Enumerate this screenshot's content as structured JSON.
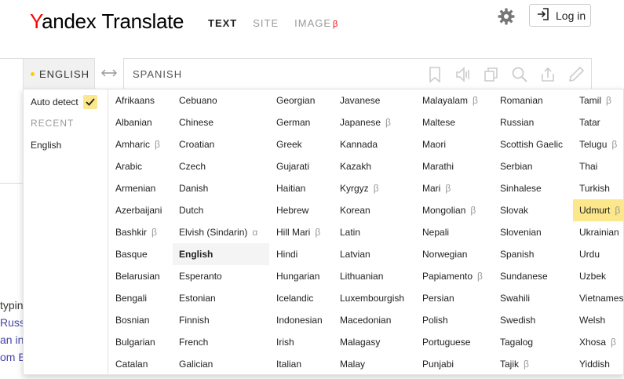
{
  "header": {
    "logo_y": "Y",
    "logo_andex": "andex",
    "logo_translate": "Translate",
    "modes": [
      {
        "label": "TEXT",
        "active": true,
        "beta": ""
      },
      {
        "label": "SITE",
        "active": false,
        "beta": ""
      },
      {
        "label": "IMAGE",
        "active": false,
        "beta": "β"
      }
    ],
    "login_label": "Log in",
    "settings_icon": "gear-icon",
    "login_icon": "login-icon"
  },
  "langbar": {
    "source": "ENGLISH",
    "target": "SPANISH",
    "swap_icon": "swap-arrows-icon",
    "tools": [
      "bookmark-icon",
      "speaker-icon",
      "copy-icon",
      "search-icon",
      "share-icon",
      "pencil-icon"
    ]
  },
  "background": {
    "lines": [
      {
        "text": "typin",
        "link": false
      },
      {
        "text": "Russ",
        "link": true
      },
      {
        "text": "an in",
        "link": true
      },
      {
        "text": "om E",
        "link": true
      }
    ]
  },
  "dropdown": {
    "auto_detect": "Auto detect",
    "recent_heading": "RECENT",
    "recent": [
      "English"
    ],
    "columns": [
      [
        {
          "name": "Afrikaans"
        },
        {
          "name": "Albanian"
        },
        {
          "name": "Amharic",
          "beta": "β"
        },
        {
          "name": "Arabic"
        },
        {
          "name": "Armenian"
        },
        {
          "name": "Azerbaijani"
        },
        {
          "name": "Bashkir",
          "beta": "β"
        },
        {
          "name": "Basque"
        },
        {
          "name": "Belarusian"
        },
        {
          "name": "Bengali"
        },
        {
          "name": "Bosnian"
        },
        {
          "name": "Bulgarian"
        },
        {
          "name": "Catalan"
        }
      ],
      [
        {
          "name": "Cebuano"
        },
        {
          "name": "Chinese"
        },
        {
          "name": "Croatian"
        },
        {
          "name": "Czech"
        },
        {
          "name": "Danish"
        },
        {
          "name": "Dutch"
        },
        {
          "name": "Elvish (Sindarin)",
          "beta": "α"
        },
        {
          "name": "English",
          "selected": true
        },
        {
          "name": "Esperanto"
        },
        {
          "name": "Estonian"
        },
        {
          "name": "Finnish"
        },
        {
          "name": "French"
        },
        {
          "name": "Galician"
        }
      ],
      [
        {
          "name": "Georgian"
        },
        {
          "name": "German"
        },
        {
          "name": "Greek"
        },
        {
          "name": "Gujarati"
        },
        {
          "name": "Haitian"
        },
        {
          "name": "Hebrew"
        },
        {
          "name": "Hill Mari",
          "beta": "β"
        },
        {
          "name": "Hindi"
        },
        {
          "name": "Hungarian"
        },
        {
          "name": "Icelandic"
        },
        {
          "name": "Indonesian"
        },
        {
          "name": "Irish"
        },
        {
          "name": "Italian"
        }
      ],
      [
        {
          "name": "Javanese"
        },
        {
          "name": "Japanese",
          "beta": "β"
        },
        {
          "name": "Kannada"
        },
        {
          "name": "Kazakh"
        },
        {
          "name": "Kyrgyz",
          "beta": "β"
        },
        {
          "name": "Korean"
        },
        {
          "name": "Latin"
        },
        {
          "name": "Latvian"
        },
        {
          "name": "Lithuanian"
        },
        {
          "name": "Luxembourgish"
        },
        {
          "name": "Macedonian"
        },
        {
          "name": "Malagasy"
        },
        {
          "name": "Malay"
        }
      ],
      [
        {
          "name": "Malayalam",
          "beta": "β"
        },
        {
          "name": "Maltese"
        },
        {
          "name": "Maori"
        },
        {
          "name": "Marathi"
        },
        {
          "name": "Mari",
          "beta": "β"
        },
        {
          "name": "Mongolian",
          "beta": "β"
        },
        {
          "name": "Nepali"
        },
        {
          "name": "Norwegian"
        },
        {
          "name": "Papiamento",
          "beta": "β"
        },
        {
          "name": "Persian"
        },
        {
          "name": "Polish"
        },
        {
          "name": "Portuguese"
        },
        {
          "name": "Punjabi"
        }
      ],
      [
        {
          "name": "Romanian"
        },
        {
          "name": "Russian"
        },
        {
          "name": "Scottish Gaelic"
        },
        {
          "name": "Serbian"
        },
        {
          "name": "Sinhalese"
        },
        {
          "name": "Slovak"
        },
        {
          "name": "Slovenian"
        },
        {
          "name": "Spanish"
        },
        {
          "name": "Sundanese"
        },
        {
          "name": "Swahili"
        },
        {
          "name": "Swedish"
        },
        {
          "name": "Tagalog"
        },
        {
          "name": "Tajik",
          "beta": "β"
        }
      ],
      [
        {
          "name": "Tamil",
          "beta": "β"
        },
        {
          "name": "Tatar"
        },
        {
          "name": "Telugu",
          "beta": "β"
        },
        {
          "name": "Thai"
        },
        {
          "name": "Turkish"
        },
        {
          "name": "Udmurt",
          "beta": "β",
          "highlighted": true
        },
        {
          "name": "Ukrainian"
        },
        {
          "name": "Urdu"
        },
        {
          "name": "Uzbek"
        },
        {
          "name": "Vietnamese"
        },
        {
          "name": "Welsh"
        },
        {
          "name": "Xhosa",
          "beta": "β"
        },
        {
          "name": "Yiddish"
        }
      ]
    ],
    "colors": {
      "highlight": "#fce78b",
      "selected_bg": "#f4f4f4",
      "beta": "#999999"
    }
  }
}
